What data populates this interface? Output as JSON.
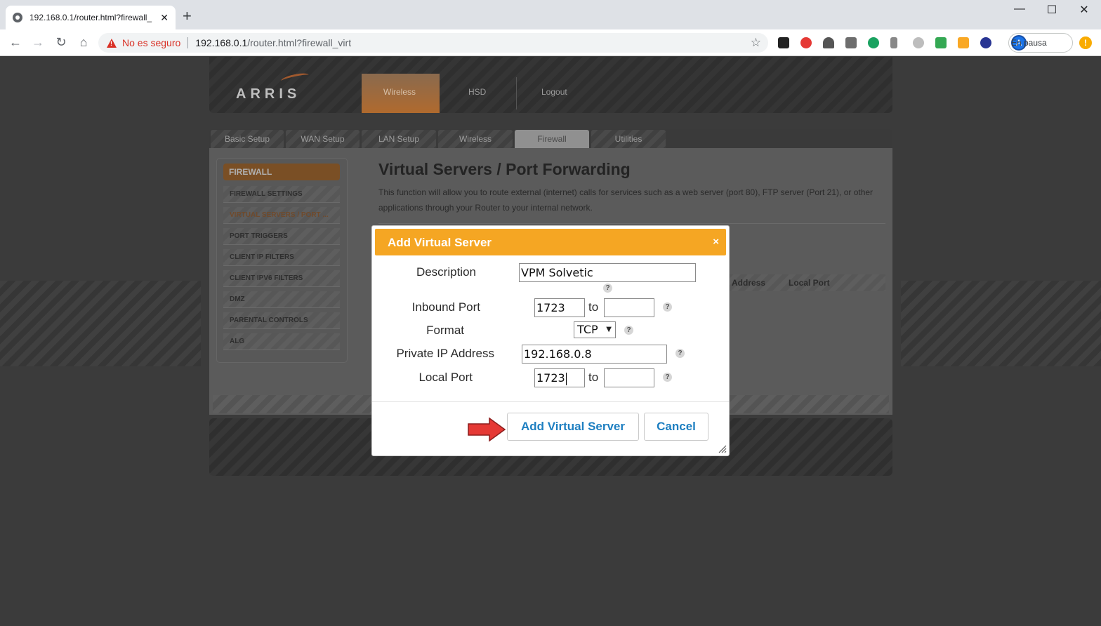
{
  "browser": {
    "tab_title": "192.168.0.1/router.html?firewall_",
    "tab_close": "✕",
    "new_tab": "+",
    "security_label": "No es seguro",
    "url_host": "192.168.0.1",
    "url_path": "/router.html?firewall_virt",
    "profile_initial": "A",
    "profile_label": "En pausa",
    "menu_badge": "!",
    "window_controls": {
      "minimize": "—",
      "maximize": "☐",
      "close": "✕"
    },
    "nav_icons": {
      "back": "←",
      "forward": "→",
      "reload": "↻",
      "home": "⌂"
    }
  },
  "router": {
    "logo": "ARRIS",
    "top_nav": [
      "Wireless",
      "HSD",
      "Logout"
    ],
    "tabs": [
      "Basic Setup",
      "WAN Setup",
      "LAN Setup",
      "Wireless",
      "Firewall",
      "Utilities"
    ],
    "active_tab": "Firewall",
    "sidebar": {
      "heading": "FIREWALL",
      "items": [
        "FIREWALL SETTINGS",
        "VIRTUAL SERVERS / PORT ...",
        "PORT TRIGGERS",
        "CLIENT IP FILTERS",
        "CLIENT IPV6 FILTERS",
        "DMZ",
        "PARENTAL CONTROLS",
        "ALG"
      ]
    },
    "page_title": "Virtual Servers / Port Forwarding",
    "page_description": "This function will allow you to route external (internet) calls for services such as a web server (port 80), FTP server (Port 21), or other applications through your Router to your internal network.",
    "table_headers": [
      "Address",
      "Local Port"
    ]
  },
  "modal": {
    "title": "Add Virtual Server",
    "close": "×",
    "labels": {
      "description": "Description",
      "inbound_port": "Inbound Port",
      "format": "Format",
      "private_ip": "Private IP Address",
      "local_port": "Local Port"
    },
    "to_label": "to",
    "help": "?",
    "values": {
      "description": "VPM Solvetic",
      "inbound_port_from": "1723",
      "inbound_port_to": "",
      "format": "TCP",
      "private_ip": "192.168.0.8",
      "local_port_from": "1723",
      "local_port_to": ""
    },
    "buttons": {
      "add": "Add Virtual Server",
      "cancel": "Cancel"
    }
  },
  "colors": {
    "modal_header": "#f5a623",
    "button_text": "#1e7fc1",
    "arrow": "#e53935",
    "insecure": "#d93025"
  }
}
